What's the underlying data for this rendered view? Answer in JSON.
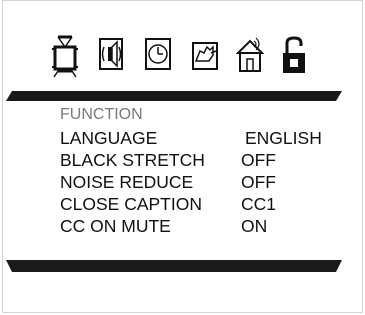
{
  "icons": [
    {
      "name": "picture-icon"
    },
    {
      "name": "audio-icon"
    },
    {
      "name": "clock-icon"
    },
    {
      "name": "parental-lock-icon"
    },
    {
      "name": "antenna-setup-icon"
    },
    {
      "name": "function-lock-icon"
    }
  ],
  "menu": {
    "title": "FUNCTION",
    "items": [
      {
        "label": "LANGUAGE",
        "value": "ENGLISH"
      },
      {
        "label": "BLACK STRETCH",
        "value": "OFF"
      },
      {
        "label": "NOISE REDUCE",
        "value": "OFF"
      },
      {
        "label": "CLOSE CAPTION",
        "value": "CC1"
      },
      {
        "label": "CC ON MUTE",
        "value": "ON"
      }
    ]
  },
  "colors": {
    "bar": "#1a1a1a",
    "text": "#111111",
    "title": "#7a7a7a",
    "selected_icon_fill": "#111111"
  }
}
